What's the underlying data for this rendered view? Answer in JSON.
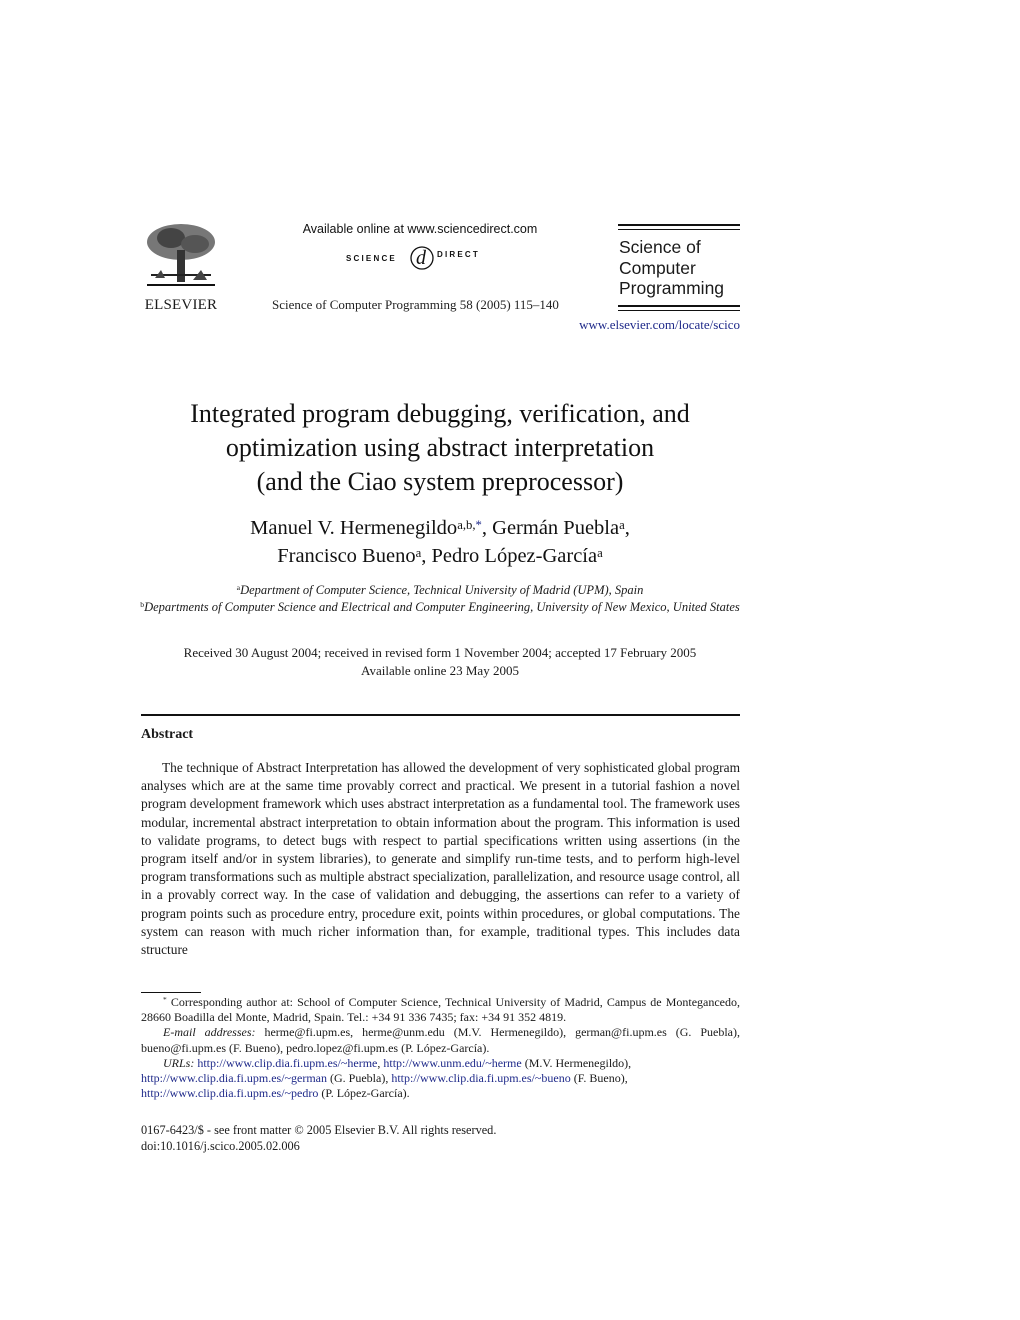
{
  "header": {
    "publisher_logo_text": "ELSEVIER",
    "available_online": "Available online at www.sciencedirect.com",
    "sciencedirect_left": "SCIENCE",
    "sciencedirect_right": "DIRECT",
    "journal_citation": "Science of Computer Programming 58 (2005) 115–140",
    "journal_name_lines": [
      "Science of",
      "Computer",
      "Programming"
    ],
    "journal_url": "www.elsevier.com/locate/scico"
  },
  "article": {
    "title_lines": [
      "Integrated program debugging, verification, and",
      "optimization using abstract interpretation",
      "(and the Ciao system preprocessor)"
    ],
    "authors": [
      {
        "name": "Manuel V. Hermenegildo",
        "aff": "a,b,",
        "star": "*",
        "sep": ", "
      },
      {
        "name": "Germán Puebla",
        "aff": "a",
        "star": "",
        "sep": ","
      },
      {
        "name": "Francisco Bueno",
        "aff": "a",
        "star": "",
        "sep": ", "
      },
      {
        "name": "Pedro López-García",
        "aff": "a",
        "star": "",
        "sep": ""
      }
    ],
    "affiliations": [
      {
        "mark": "a",
        "text": "Department of Computer Science, Technical University of Madrid (UPM), Spain"
      },
      {
        "mark": "b",
        "text": "Departments of Computer Science and Electrical and Computer Engineering, University of New Mexico, United States"
      }
    ],
    "dates_line1": "Received 30 August 2004; received in revised form 1 November 2004; accepted 17 February 2005",
    "dates_line2": "Available online 23 May 2005"
  },
  "abstract": {
    "heading": "Abstract",
    "body": "The technique of Abstract Interpretation has allowed the development of very sophisticated global program analyses which are at the same time provably correct and practical. We present in a tutorial fashion a novel program development framework which uses abstract interpretation as a fundamental tool. The framework uses modular, incremental abstract interpretation to obtain information about the program. This information is used to validate programs, to detect bugs with respect to partial specifications written using assertions (in the program itself and/or in system libraries), to generate and simplify run-time tests, and to perform high-level program transformations such as multiple abstract specialization, parallelization, and resource usage control, all in a provably correct way. In the case of validation and debugging, the assertions can refer to a variety of program points such as procedure entry, procedure exit, points within procedures, or global computations. The system can reason with much richer information than, for example, traditional types. This includes data structure"
  },
  "footnotes": {
    "corresponding_mark": "*",
    "corresponding": "Corresponding author at: School of Computer Science, Technical University of Madrid, Campus de Montegancedo, 28660 Boadilla del Monte, Madrid, Spain. Tel.: +34 91 336 7435; fax: +34 91 352 4819.",
    "email_label": "E-mail addresses:",
    "emails": "herme@fi.upm.es, herme@unm.edu (M.V. Hermenegildo), german@fi.upm.es (G. Puebla), bueno@fi.upm.es (F. Bueno), pedro.lopez@fi.upm.es (P. López-García).",
    "urls_label": "URLs:",
    "urls": [
      {
        "url": "http://www.clip.dia.fi.upm.es/~herme",
        "who": ","
      },
      {
        "url": "http://www.unm.edu/~herme",
        "who": "(M.V. Hermenegildo),"
      },
      {
        "url": "http://www.clip.dia.fi.upm.es/~german",
        "who": "(G. Puebla),"
      },
      {
        "url": "http://www.clip.dia.fi.upm.es/~bueno",
        "who": "(F. Bueno),"
      },
      {
        "url": "http://www.clip.dia.fi.upm.es/~pedro",
        "who": "(P. López-García)."
      }
    ]
  },
  "front_matter": {
    "line1": "0167-6423/$ - see front matter © 2005 Elsevier B.V. All rights reserved.",
    "doi": "doi:10.1016/j.scico.2005.02.006"
  },
  "colors": {
    "link": "#1f2a8a",
    "text": "#1a1a1a"
  }
}
